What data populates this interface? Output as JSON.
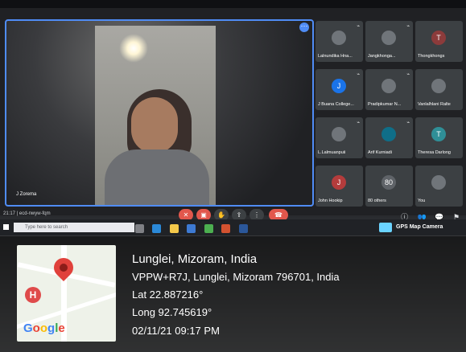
{
  "meeting": {
    "main_speaker": "J Zorema",
    "meeting_code": "ecd-nwyw-fqm",
    "clock": "21:17"
  },
  "participants": [
    {
      "name": "Lalnundika Hna...",
      "initial": "",
      "color": "#70757a"
    },
    {
      "name": "Jangkhonga...",
      "initial": "",
      "color": "#70757a"
    },
    {
      "name": "Thongkhongs",
      "initial": "T",
      "color": "#8c3b3b"
    },
    {
      "name": "J Buana College...",
      "initial": "J",
      "color": "#1a73e8"
    },
    {
      "name": "Pradipkumar N...",
      "initial": "",
      "color": "#70757a"
    },
    {
      "name": "Vanlalhlani Ralte",
      "initial": "",
      "color": "#70757a"
    },
    {
      "name": "L.Lalmuanpuii",
      "initial": "",
      "color": "#70757a"
    },
    {
      "name": "Arif Kurniadi",
      "initial": "",
      "color": "#0f6e88"
    },
    {
      "name": "Theresa Darlong",
      "initial": "T",
      "color": "#2f8f97"
    },
    {
      "name": "John Hookip",
      "initial": "J",
      "color": "#b43c3c"
    },
    {
      "name": "80 others",
      "initial": "80",
      "color": "#5f6368"
    },
    {
      "name": "You",
      "initial": "",
      "color": "#70757a"
    }
  ],
  "taskbar": {
    "search_placeholder": "Type here to search",
    "gps_app": "GPS Map Camera"
  },
  "location": {
    "city": "Lunglei, Mizoram, India",
    "address": "VPPW+R7J, Lunglei, Mizoram 796701, India",
    "lat": "Lat 22.887216°",
    "long": "Long 92.745619°",
    "datetime": "02/11/21 09:17 PM",
    "map_brand": "Google"
  }
}
